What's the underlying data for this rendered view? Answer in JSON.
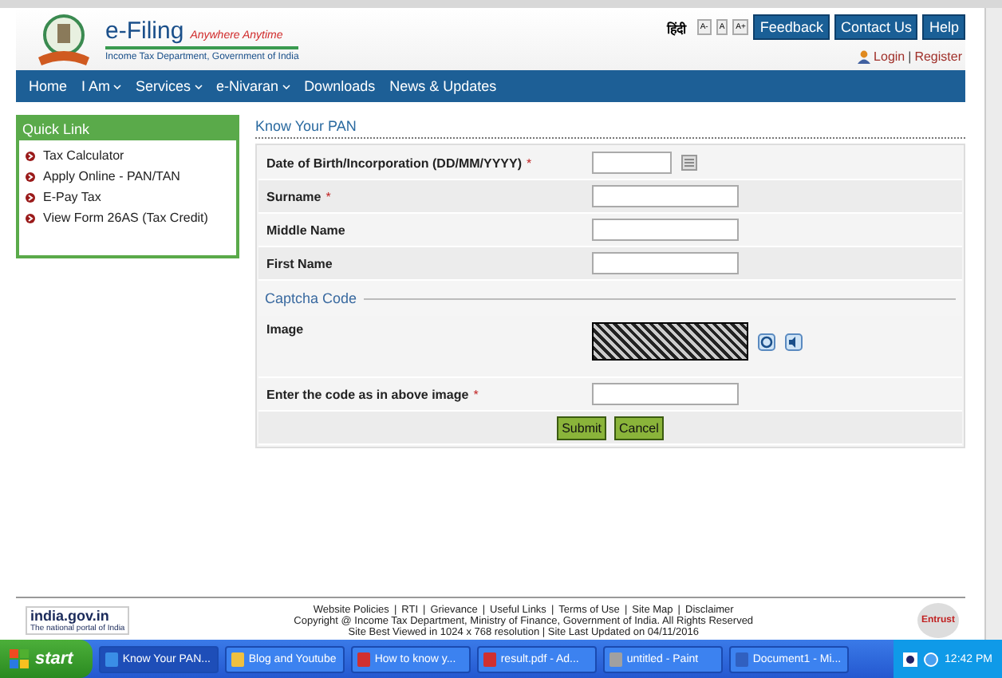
{
  "header": {
    "title": "e-Filing",
    "tagline": "Anywhere Anytime",
    "subtitle": "Income Tax Department, Government of India",
    "language": "हिंदी",
    "font_sizes": [
      "A-",
      "A",
      "A+"
    ],
    "buttons": [
      "Feedback",
      "Contact Us",
      "Help"
    ],
    "login": "Login",
    "separator": "|",
    "register": "Register"
  },
  "nav": [
    {
      "label": "Home",
      "has_dropdown": false
    },
    {
      "label": "I Am",
      "has_dropdown": true
    },
    {
      "label": "Services",
      "has_dropdown": true
    },
    {
      "label": "e-Nivaran",
      "has_dropdown": true
    },
    {
      "label": "Downloads",
      "has_dropdown": false
    },
    {
      "label": "News & Updates",
      "has_dropdown": false
    }
  ],
  "quick_link": {
    "title": "Quick Link",
    "items": [
      "Tax Calculator",
      "Apply Online - PAN/TAN",
      "E-Pay Tax",
      "View Form 26AS (Tax Credit)"
    ]
  },
  "form": {
    "title": "Know Your PAN",
    "fields": [
      {
        "label": "Date of Birth/Incorporation (DD/MM/YYYY)",
        "required_mark": "*",
        "kind": "date"
      },
      {
        "label": "Surname",
        "required_mark": "*",
        "kind": "text"
      },
      {
        "label": "Middle Name",
        "kind": "text"
      },
      {
        "label": "First Name",
        "kind": "text"
      }
    ],
    "captcha_legend": "Captcha Code",
    "captcha_label": "Image",
    "code_label": "Enter the code as in above image",
    "code_mark": "*",
    "buttons": [
      "Submit",
      "Cancel"
    ]
  },
  "footer": {
    "links": [
      "Website Policies",
      "RTI",
      "Grievance",
      "Useful Links",
      "Terms of Use",
      "Site Map",
      "Disclaimer"
    ],
    "copyright": "Copyright @ Income Tax Department, Ministry of Finance, Government of India. All Rights Reserved",
    "note": "Site Best Viewed in 1024 x 768 resolution | Site Last Updated on 04/11/2016",
    "portal": "india.gov.in",
    "portal_sub": "The national portal of India",
    "seal": "Entrust"
  },
  "taskbar": {
    "start": "start",
    "tasks": [
      {
        "label": "Know Your PAN...",
        "kind": "browser",
        "selected": true
      },
      {
        "label": "Blog and Youtube",
        "kind": "folder",
        "selected": false
      },
      {
        "label": "How to know y...",
        "kind": "pdf",
        "selected": false
      },
      {
        "label": "result.pdf - Ad...",
        "kind": "pdf",
        "selected": false
      },
      {
        "label": "untitled - Paint",
        "kind": "paint",
        "selected": false
      },
      {
        "label": "Document1 - Mi...",
        "kind": "doc",
        "selected": false
      }
    ],
    "clock": "12:42 PM"
  }
}
